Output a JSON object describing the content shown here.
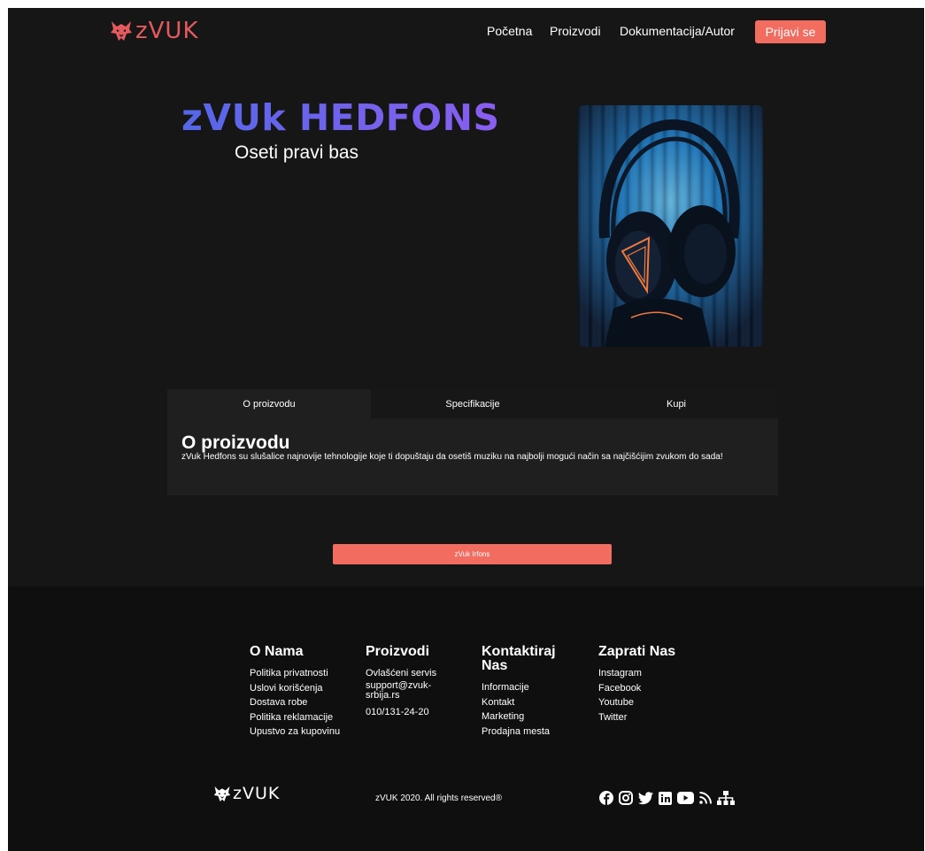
{
  "header": {
    "logo_text": "zVUK",
    "nav": [
      "Početna",
      "Proizvodi",
      "Dokumentacija/Autor"
    ],
    "login_label": "Prijavi se"
  },
  "hero": {
    "title": "zVUk HEDFONS",
    "subtitle": "Oseti pravi bas",
    "image_icon": "headphones-photo"
  },
  "tabs": {
    "labels": [
      "O proizvodu",
      "Specifikacije",
      "Kupi"
    ],
    "active": 0,
    "panel_title": "O proizvodu",
    "panel_text": "zVuk Hedfons su slušalice najnovije tehnologije koje ti dopuštaju da osetiš muziku na najbolji mogući način sa najčišćijim zvukom do sada!"
  },
  "product_button": "zVuk Irfons",
  "footer": {
    "columns": [
      {
        "title": "O Nama",
        "items": [
          "Politika privatnosti",
          "Uslovi korišćenja",
          "Dostava robe",
          "Politika reklamacije",
          "Upustvo za kupovinu"
        ]
      },
      {
        "title": "Proizvodi",
        "items": [
          "Ovlašćeni servis",
          "support@zvuk-srbija.rs",
          "010/131-24-20"
        ]
      },
      {
        "title": "Kontaktiraj Nas",
        "items": [
          "Informacije",
          "Kontakt",
          "Marketing",
          "Prodajna mesta"
        ]
      },
      {
        "title": "Zaprati Nas",
        "items": [
          "Instagram",
          "Facebook",
          "Youtube",
          "Twitter"
        ]
      }
    ],
    "logo_text": "zVUK",
    "copyright": "zVUK 2020. All rights reserved®",
    "social_icons": [
      "facebook-icon",
      "instagram-icon",
      "twitter-icon",
      "linkedin-icon",
      "youtube-icon",
      "rss-icon",
      "sitemap-icon"
    ]
  },
  "colors": {
    "accent": "#f26c60",
    "logo_red": "#e35a5f",
    "background": "#161616",
    "footer_bg": "#0f0f0f",
    "title_gradient": [
      "#5567e8",
      "#8a5ef0"
    ]
  }
}
